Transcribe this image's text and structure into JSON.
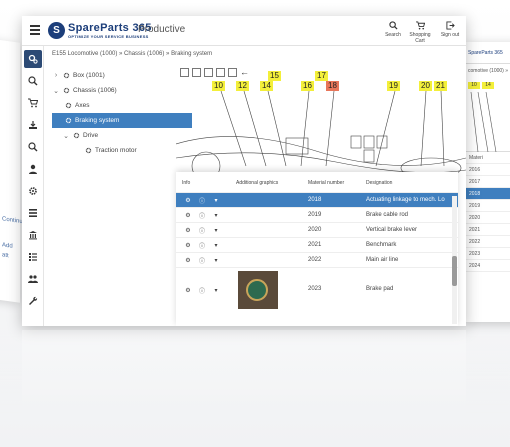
{
  "app": {
    "brand": "SpareParts 365",
    "tagline": "OPTIMIZE YOUR SERVICE BUSINESS",
    "mode": "Productive"
  },
  "header_actions": [
    {
      "label": "Search",
      "icon": "search-icon"
    },
    {
      "label": "Shopping Cart",
      "icon": "cart-icon"
    },
    {
      "label": "Sign out",
      "icon": "sign-out-icon"
    }
  ],
  "breadcrumb": "E155 Locomotive (1000) » Chassis (1006) » Braking system",
  "tree": [
    {
      "label": "Box (1001)",
      "expanded": false
    },
    {
      "label": "Chassis (1006)",
      "expanded": true
    },
    {
      "label": "Axes"
    },
    {
      "label": "Braking system",
      "selected": true
    },
    {
      "label": "Drive",
      "expanded": true
    },
    {
      "label": "Traction motor"
    }
  ],
  "callouts": [
    {
      "label": "15"
    },
    {
      "label": "17"
    },
    {
      "label": "10"
    },
    {
      "label": "12"
    },
    {
      "label": "14"
    },
    {
      "label": "16"
    },
    {
      "label": "18",
      "color": "#e8765a"
    },
    {
      "label": "19"
    },
    {
      "label": "20"
    },
    {
      "label": "21"
    }
  ],
  "table": {
    "columns": [
      "Info",
      "Additional graphics",
      "Material number",
      "Designation"
    ],
    "rows": [
      {
        "material": "2018",
        "designation": "Actuating linkage to mech. Lo",
        "selected": true
      },
      {
        "material": "2019",
        "designation": "Brake cable rod"
      },
      {
        "material": "2020",
        "designation": "Vertical brake lever"
      },
      {
        "material": "2021",
        "designation": "Benchmark"
      },
      {
        "material": "2022",
        "designation": "Main air line"
      },
      {
        "material": "2023",
        "designation": "Brake pad",
        "has_image": true
      }
    ]
  },
  "ghost_right": {
    "crumb": "comotive (1000) »",
    "header_col": "Materi",
    "rows": [
      "2016",
      "2017",
      "2018",
      "2019",
      "2020",
      "2021",
      "2022",
      "2023",
      "2024"
    ],
    "callouts": [
      "10",
      "14"
    ]
  },
  "ghost_left": {
    "texts": [
      "Continu",
      "Add",
      "att"
    ]
  },
  "colors": {
    "accent": "#3f7fbf",
    "sidebar_active": "#2c4a75",
    "brand": "#1c3e7a",
    "callout": "#f3ef3a"
  }
}
